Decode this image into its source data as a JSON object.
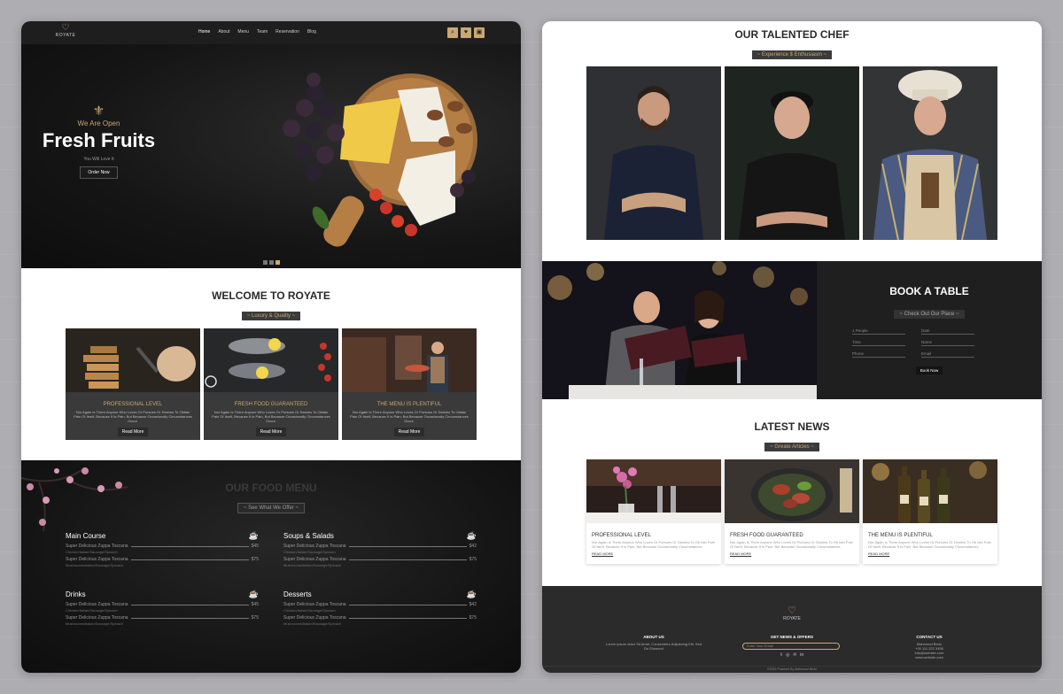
{
  "brand": {
    "name": "ROYATE"
  },
  "nav": {
    "links": [
      "Home",
      "About",
      "Menu",
      "Team",
      "Reservation",
      "Blog"
    ],
    "icons": [
      "search-icon",
      "heart-icon",
      "cart-icon"
    ]
  },
  "hero": {
    "open": "We Are Open",
    "title": "Fresh Fruits",
    "subtitle": "You Will Love It",
    "button": "Order Now",
    "slides": 3,
    "active_slide": 3
  },
  "welcome": {
    "title": "WELCOME TO ROYATE",
    "subtitle": "~ Luxury & Quality ~",
    "cards": [
      {
        "title": "PROFESSIONAL LEVEL",
        "desc": "Nor Again Is There Anyone Who Loves Or Pursues Or Desires To Obtain Pain Of Itself, Because It Is Pain, But Because Occasionally Circumstances Occur.",
        "button": "Read More"
      },
      {
        "title": "FRESH FOOD GUARANTEED",
        "desc": "Nor Again Is There Anyone Who Loves Or Pursues Or Desires To Obtain Pain Of Itself, Because It Is Pain, But Because Occasionally Circumstances Occur.",
        "button": "Read More"
      },
      {
        "title": "THE MENU IS PLENTIFUL",
        "desc": "Nor Again Is There Anyone Who Loves Or Pursues Or Desires To Obtain Pain Of Itself, Because It Is Pain, But Because Occasionally Circumstances Occur.",
        "button": "Read More"
      }
    ]
  },
  "food_menu": {
    "title": "OUR FOOD MENU",
    "subtitle": "~ See What We Offer ~",
    "sections": [
      {
        "name": "Main Course",
        "items": [
          {
            "name": "Super Delicious Zuppa Toscana",
            "price": "$45",
            "desc": "Chicken/Italian/Sausage/Spinach"
          },
          {
            "name": "Super Delicious Zuppa Toscana",
            "price": "$75",
            "desc": "Mushrooms/Italian/Sausage/Spinach"
          }
        ]
      },
      {
        "name": "Soups & Salads",
        "items": [
          {
            "name": "Super Delicious Zuppa Toscana",
            "price": "$42",
            "desc": "Chicken/Italian/Sausage/Spinach"
          },
          {
            "name": "Super Delicious Zuppa Toscana",
            "price": "$75",
            "desc": "Mushrooms/Italian/Sausage/Spinach"
          }
        ]
      },
      {
        "name": "Drinks",
        "items": [
          {
            "name": "Super Delicious Zuppa Toscana",
            "price": "$45",
            "desc": "Chicken/Italian/Sausage/Spinach"
          },
          {
            "name": "Super Delicious Zuppa Toscana",
            "price": "$75",
            "desc": "Mushrooms/Italian/Sausage/Spinach"
          }
        ]
      },
      {
        "name": "Desserts",
        "items": [
          {
            "name": "Super Delicious Zuppa Toscana",
            "price": "$42",
            "desc": "Chicken/Italian/Sausage/Spinach"
          },
          {
            "name": "Super Delicious Zuppa Toscana",
            "price": "$75",
            "desc": "Mushrooms/Italian/Sausage/Spinach"
          }
        ]
      }
    ]
  },
  "chefs": {
    "title": "OUR TALENTED CHEF",
    "subtitle": "~ Experience $ Enthusiasm ~"
  },
  "book": {
    "title": "BOOK A TABLE",
    "subtitle": "~ Check Out Our Place ~",
    "fields": {
      "people": "1 People",
      "date": "Date",
      "time": "Time",
      "name": "Name",
      "phone": "Phone",
      "email": "Email"
    },
    "button": "Book Now"
  },
  "news": {
    "title": "LATEST NEWS",
    "subtitle": "~ Greate Articles ~",
    "cards": [
      {
        "title": "PROFESSIONAL LEVEL",
        "desc": "Nor Again Is There Anyone Who Loves Or Pursues Or Desires To Ob tain Pain Of Itself, Because It Is Pain, But Because Occasionally Circumstances",
        "link": "READ MORE"
      },
      {
        "title": "FRESH FOOD GUARANTEED",
        "desc": "Nor Again Is There Anyone Who Loves Or Pursues Or Desires To Ob tain Pain Of Itself, Because It Is Pain, But Because Occasionally Circumstances",
        "link": "READ MORE"
      },
      {
        "title": "THE MENU IS PLENTIFUL",
        "desc": "Nor Again Is There Anyone Who Loves Or Pursues Or Desires To Ob tain Pain Of Itself, Because It Is Pain, But Because Occasionally Circumstances",
        "link": "READ MORE"
      }
    ]
  },
  "footer": {
    "about_title": "ABOUT US",
    "about_text": "Lorem ipsum dolor Sit Amet, Consectetur Adipiscing Elit. Sed Do Eiusmod",
    "news_title": "GET NEWS & OFFERS",
    "news_placeholder": "Enter Your Email",
    "contact_title": "CONTACT US",
    "contact_lines": [
      "Mahmoud Bedo",
      "+00 111 222 3456",
      "info@website.com",
      "www.website.com"
    ],
    "copyright": "©2021 Powered By Mahmoud Bedo"
  },
  "colors": {
    "accent": "#c9a874",
    "dark": "#1e1e1e"
  }
}
